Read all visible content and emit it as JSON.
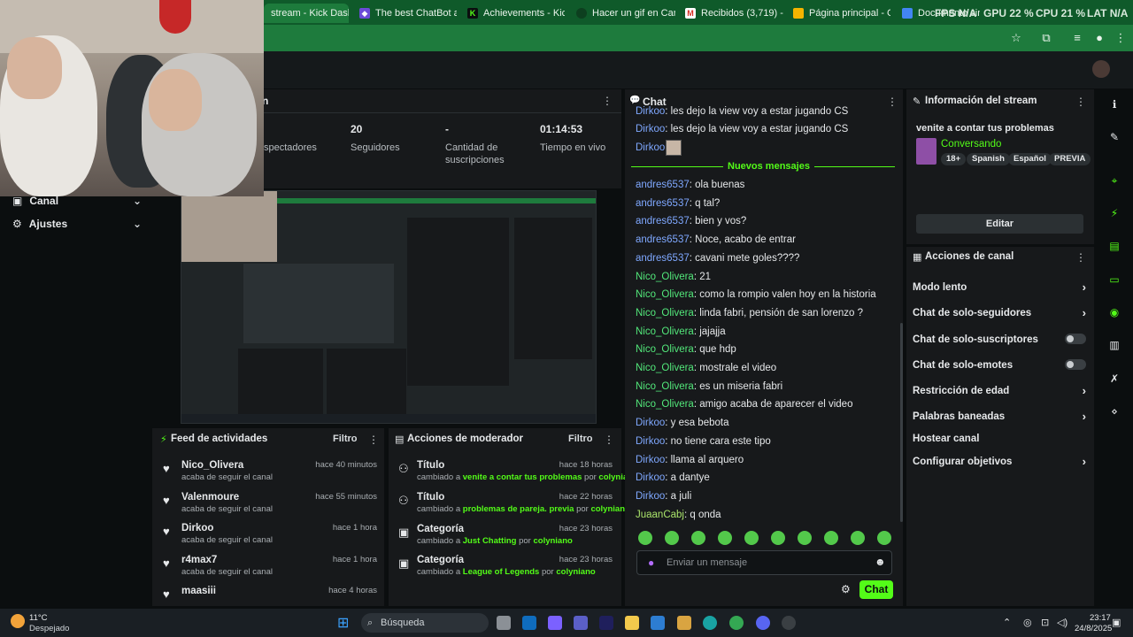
{
  "colors": {
    "kick_green": "#53fc18",
    "tab_bar": "#0f5a2a",
    "panel": "#17191b"
  },
  "browser": {
    "tabs": [
      {
        "label": "stream - Kick Dashbo",
        "icon": "kick-icon"
      },
      {
        "label": "The best ChatBot and",
        "icon": "botrix-icon"
      },
      {
        "label": "Achievements - Kick",
        "icon": "kick-icon"
      },
      {
        "label": "Hacer un gif en Canv",
        "icon": "canva-icon"
      },
      {
        "label": "Recibidos (3,719) - al",
        "icon": "gmail-icon"
      },
      {
        "label": "Página principal - Go",
        "icon": "drive-icon"
      },
      {
        "label": "Documento sin título",
        "icon": "docs-icon"
      }
    ]
  },
  "hud": {
    "fps": "FPS N/A",
    "gpu": "GPU 22 %",
    "cpu": "CPU 21 %",
    "lat": "LAT N/A"
  },
  "sidebar": {
    "items": [
      {
        "label": "Canal"
      },
      {
        "label": "Ajustes"
      }
    ]
  },
  "stream_panel": {
    "title_fragment": "n",
    "stats": [
      {
        "value": "",
        "label": "spectadores"
      },
      {
        "value": "20",
        "label": "Seguidores"
      },
      {
        "value": "-",
        "label": "Cantidad de suscripciones"
      },
      {
        "value": "01:14:53",
        "label": "Tiempo en vivo"
      }
    ]
  },
  "chat": {
    "title": "Chat",
    "top_lines": [
      {
        "user": "Dirkoo",
        "text": "les dejo la view voy a estar jugando CS"
      },
      {
        "user": "Dirkoo",
        "text": "les dejo la view voy a estar jugando CS"
      },
      {
        "user": "Dirkoo",
        "text": ""
      }
    ],
    "new_messages_label": "Nuevos mensajes",
    "messages": [
      {
        "user": "andres6537",
        "text": "ola buenas",
        "c": "blue"
      },
      {
        "user": "andres6537",
        "text": "q tal?",
        "c": "blue"
      },
      {
        "user": "andres6537",
        "text": "bien y vos?",
        "c": "blue"
      },
      {
        "user": "andres6537",
        "text": "Noce, acabo de entrar",
        "c": "blue"
      },
      {
        "user": "andres6537",
        "text": "cavani mete goles????",
        "c": "blue"
      },
      {
        "user": "Nico_Olivera",
        "text": "21",
        "c": "green"
      },
      {
        "user": "Nico_Olivera",
        "text": "como la rompio valen hoy en la historia",
        "c": "green"
      },
      {
        "user": "Nico_Olivera",
        "text": "linda fabri, pensión de san lorenzo ?",
        "c": "green"
      },
      {
        "user": "Nico_Olivera",
        "text": "jajajja",
        "c": "green"
      },
      {
        "user": "Nico_Olivera",
        "text": "que hdp",
        "c": "green"
      },
      {
        "user": "Nico_Olivera",
        "text": "mostrale el video",
        "c": "green"
      },
      {
        "user": "Nico_Olivera",
        "text": "es un miseria fabri",
        "c": "green"
      },
      {
        "user": "Nico_Olivera",
        "text": "amigo acaba de aparecer el video",
        "c": "green"
      },
      {
        "user": "Dirkoo",
        "text": "y esa bebota",
        "c": "blue"
      },
      {
        "user": "Dirkoo",
        "text": "no tiene cara este tipo",
        "c": "blue"
      },
      {
        "user": "Dirkoo",
        "text": "llama al arquero",
        "c": "blue"
      },
      {
        "user": "Dirkoo",
        "text": "a dantye",
        "c": "blue"
      },
      {
        "user": "Dirkoo",
        "text": "a juli",
        "c": "blue"
      },
      {
        "user": "JuaanCabj",
        "text": "q onda",
        "c": "olive"
      }
    ],
    "input_placeholder": "Enviar un mensaje",
    "send_label": "Chat"
  },
  "stream_info": {
    "title": "Información del stream",
    "stream_title": "venite a contar tus problemas",
    "category": "Conversando",
    "tags": [
      "18+",
      "Spanish",
      "Español",
      "PREVIA"
    ],
    "edit_label": "Editar"
  },
  "channel_actions": {
    "title": "Acciones de canal",
    "rows": [
      {
        "label": "Modo lento",
        "kind": "arrow"
      },
      {
        "label": "Chat de solo-seguidores",
        "kind": "arrow"
      },
      {
        "label": "Chat de solo-suscriptores",
        "kind": "toggle"
      },
      {
        "label": "Chat de solo-emotes",
        "kind": "toggle"
      },
      {
        "label": "Restricción de edad",
        "kind": "arrow"
      },
      {
        "label": "Palabras baneadas",
        "kind": "arrow"
      },
      {
        "label": "Hostear canal",
        "kind": "none"
      },
      {
        "label": "Configurar objetivos",
        "kind": "arrow"
      }
    ]
  },
  "activity_feed": {
    "title": "Feed de actividades",
    "filter_label": "Filtro",
    "items": [
      {
        "name": "Nico_Olivera",
        "sub": "acaba de seguir el canal",
        "time": "hace 40 minutos"
      },
      {
        "name": "Valenmoure",
        "sub": "acaba de seguir el canal",
        "time": "hace 55 minutos"
      },
      {
        "name": "Dirkoo",
        "sub": "acaba de seguir el canal",
        "time": "hace 1 hora"
      },
      {
        "name": "r4max7",
        "sub": "acaba de seguir el canal",
        "time": "hace 1 hora"
      },
      {
        "name": "maasiii",
        "sub": "",
        "time": "hace 4 horas"
      }
    ]
  },
  "mod_actions": {
    "title": "Acciones de moderador",
    "filter_label": "Filtro",
    "items": [
      {
        "kind": "Título",
        "prefix": "cambiado a",
        "value": "venite a contar tus problemas",
        "by": "por",
        "user": "colyniano",
        "time": "hace 18 horas",
        "icon": "title-icon"
      },
      {
        "kind": "Título",
        "prefix": "cambiado a",
        "value": "problemas de pareja. previa",
        "by": "por",
        "user": "colyniano",
        "time": "hace 22 horas",
        "icon": "title-icon"
      },
      {
        "kind": "Categoría",
        "prefix": "cambiado a",
        "value": "Just Chatting",
        "by": "por",
        "user": "colyniano",
        "time": "hace 23 horas",
        "icon": "category-icon"
      },
      {
        "kind": "Categoría",
        "prefix": "cambiado a",
        "value": "League of Legends",
        "by": "por",
        "user": "colyniano",
        "time": "hace 23 horas",
        "icon": "category-icon"
      }
    ]
  },
  "taskbar": {
    "weather_temp": "11°C",
    "weather_desc": "Despejado",
    "search_placeholder": "Búsqueda",
    "time": "23:17",
    "date": "24/8/2025"
  }
}
